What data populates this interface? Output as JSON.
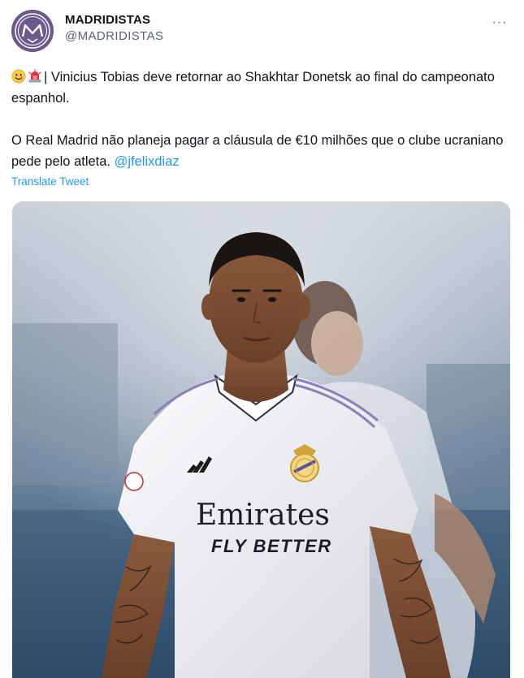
{
  "account": {
    "display_name": "MADRIDISTAS",
    "handle": "@MADRIDISTAS",
    "avatar_icon": "madridistas-logo-icon",
    "avatar_color": "#6d5a8c"
  },
  "header": {
    "more_icon": "more-options-icon",
    "more_label": "···"
  },
  "tweet": {
    "line1_emojis": [
      "smiling-face-icon",
      "police-light-icon"
    ],
    "line1_text": "| Vinicius Tobias deve retornar ao Shakhtar Donetsk ao final do campeonato espanhol.",
    "line2_text": "O Real Madrid não planeja pagar a cláusula de €10 milhões que o clube ucraniano pede pelo atleta.",
    "mention": "@jfelixdiaz",
    "translate_label": "Translate Tweet"
  },
  "media": {
    "shirt_sponsor_line1": "Emirates",
    "shirt_sponsor_line2": "FLY BETTER",
    "colors": {
      "link": "#1d9bf0",
      "shirt": "#f2f2f4",
      "accent_purple": "#8a7fb6"
    }
  }
}
